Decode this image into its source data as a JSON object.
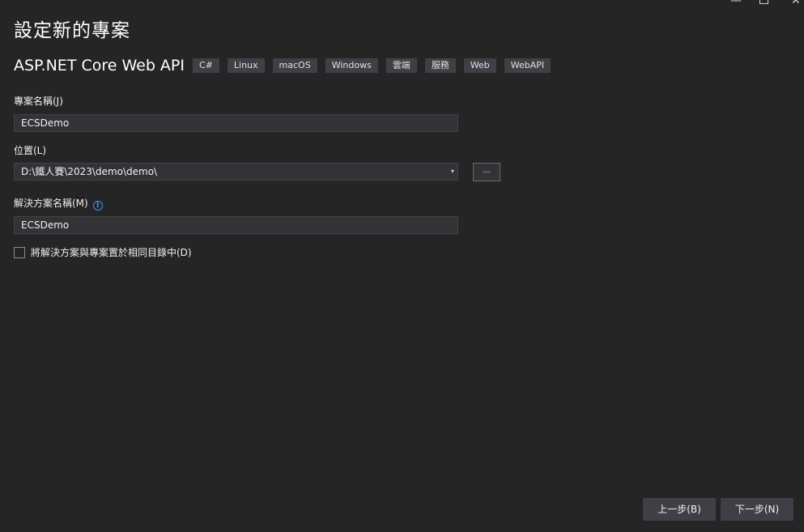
{
  "dialog": {
    "title": "設定新的專案",
    "window_controls": {
      "minimize": "—",
      "close": "✕"
    }
  },
  "template": {
    "name": "ASP.NET Core Web API",
    "tags": [
      "C#",
      "Linux",
      "macOS",
      "Windows",
      "雲端",
      "服務",
      "Web",
      "WebAPI"
    ]
  },
  "project_name": {
    "label": "專案名稱(J)",
    "value": "ECSDemo"
  },
  "location": {
    "label": "位置(L)",
    "value": "D:\\鐵人賽\\2023\\demo\\demo\\",
    "dropdown_caret": "▾",
    "browse_label": "..."
  },
  "solution_name": {
    "label": "解決方案名稱(M)",
    "info_icon": "i",
    "value": "ECSDemo"
  },
  "same_directory": {
    "label": "將解決方案與專案置於相同目錄中(D)",
    "checked": false
  },
  "buttons": {
    "back": "上一步(B)",
    "next": "下一步(N)"
  },
  "colors": {
    "background": "#252526",
    "input_background": "#333337",
    "tag_background": "#3f3f46",
    "info_accent": "#3794ff"
  }
}
